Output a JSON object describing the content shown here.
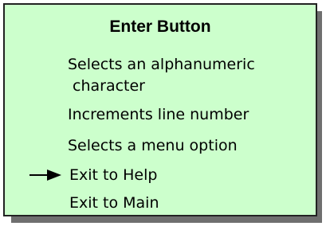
{
  "card": {
    "title": "Enter Button",
    "items": [
      "Selects an alphanumeric",
      "character",
      "Increments line number",
      "Selects a menu option",
      "Exit to Help",
      "Exit to Main"
    ],
    "selected_icon": "arrow-right-icon"
  },
  "colors": {
    "card_background": "#ccffcc",
    "shadow": "#6f6f6f",
    "border": "#222222"
  }
}
